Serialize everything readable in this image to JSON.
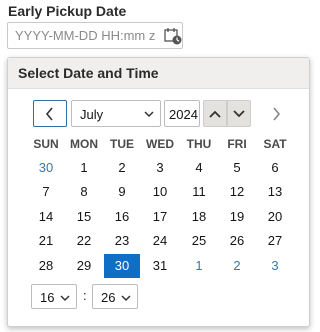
{
  "field": {
    "label": "Early Pickup Date",
    "placeholder": "YYYY-MM-DD HH:mm z",
    "icon": "calendar-clock-icon"
  },
  "popup": {
    "title": "Select Date and Time",
    "month": "July",
    "year": "2024",
    "weekdays": [
      "SUN",
      "MON",
      "TUE",
      "WED",
      "THU",
      "FRI",
      "SAT"
    ],
    "weeks": [
      [
        "30",
        "1",
        "2",
        "3",
        "4",
        "5",
        "6"
      ],
      [
        "7",
        "8",
        "9",
        "10",
        "11",
        "12",
        "13"
      ],
      [
        "14",
        "15",
        "16",
        "17",
        "18",
        "19",
        "20"
      ],
      [
        "21",
        "22",
        "23",
        "24",
        "25",
        "26",
        "27"
      ],
      [
        "28",
        "29",
        "30",
        "31",
        "1",
        "2",
        "3"
      ]
    ],
    "other_month_days": [
      "0-0",
      "4-4",
      "4-5",
      "4-6"
    ],
    "selected_day": "4-2",
    "hour": "16",
    "minute": "26",
    "time_separator": ":"
  },
  "colors": {
    "accent": "#0f6fc6",
    "other_month": "#3a78a8"
  }
}
